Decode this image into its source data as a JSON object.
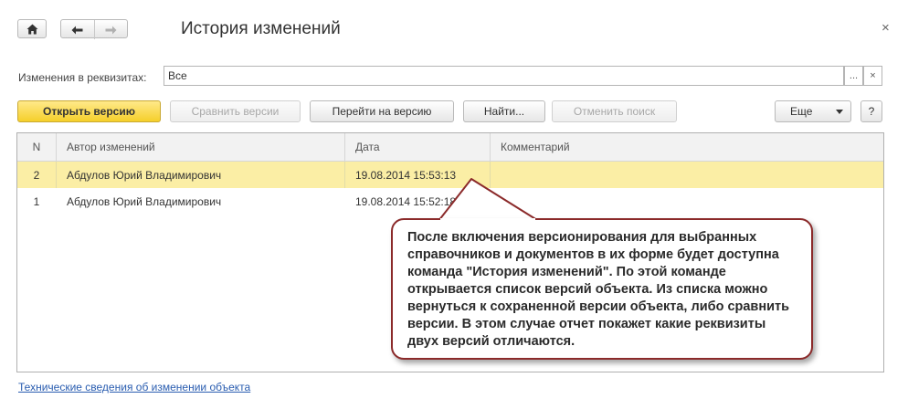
{
  "window": {
    "title": "История изменений",
    "close_label": "×"
  },
  "nav": {
    "home_icon": "home-icon",
    "back_icon": "arrow-left-icon",
    "forward_icon": "arrow-right-icon"
  },
  "filter": {
    "label": "Изменения в реквизитах:",
    "value": "Все",
    "select_label": "...",
    "clear_label": "×"
  },
  "toolbar": {
    "open_version": "Открыть версию",
    "compare_versions": "Сравнить версии",
    "goto_version": "Перейти на версию",
    "find": "Найти...",
    "cancel_search": "Отменить поиск",
    "more": "Еще",
    "help": "?"
  },
  "table": {
    "columns": [
      "N",
      "Автор изменений",
      "Дата",
      "Комментарий"
    ],
    "rows": [
      {
        "n": "2",
        "author": "Абдулов Юрий Владимирович",
        "date": "19.08.2014 15:53:13",
        "comment": "",
        "selected": true
      },
      {
        "n": "1",
        "author": "Абдулов Юрий Владимирович",
        "date": "19.08.2014 15:52:18",
        "comment": "",
        "selected": false
      }
    ]
  },
  "callout": {
    "text": "После включения версионирования для выбранных справочников и документов в их форме будет доступна команда \"История изменений\". По этой команде открывается список версий объекта. Из списка можно вернуться к сохраненной версии объекта, либо сравнить версии. В этом случае отчет покажет какие реквизиты двух версий отличаются.",
    "border_color": "#8b2a2a"
  },
  "footer": {
    "link": "Технические сведения об изменении объекта"
  },
  "colors": {
    "primary_button": "#f5cf2a",
    "selected_row": "#fbeea5",
    "link": "#2a5db0"
  }
}
